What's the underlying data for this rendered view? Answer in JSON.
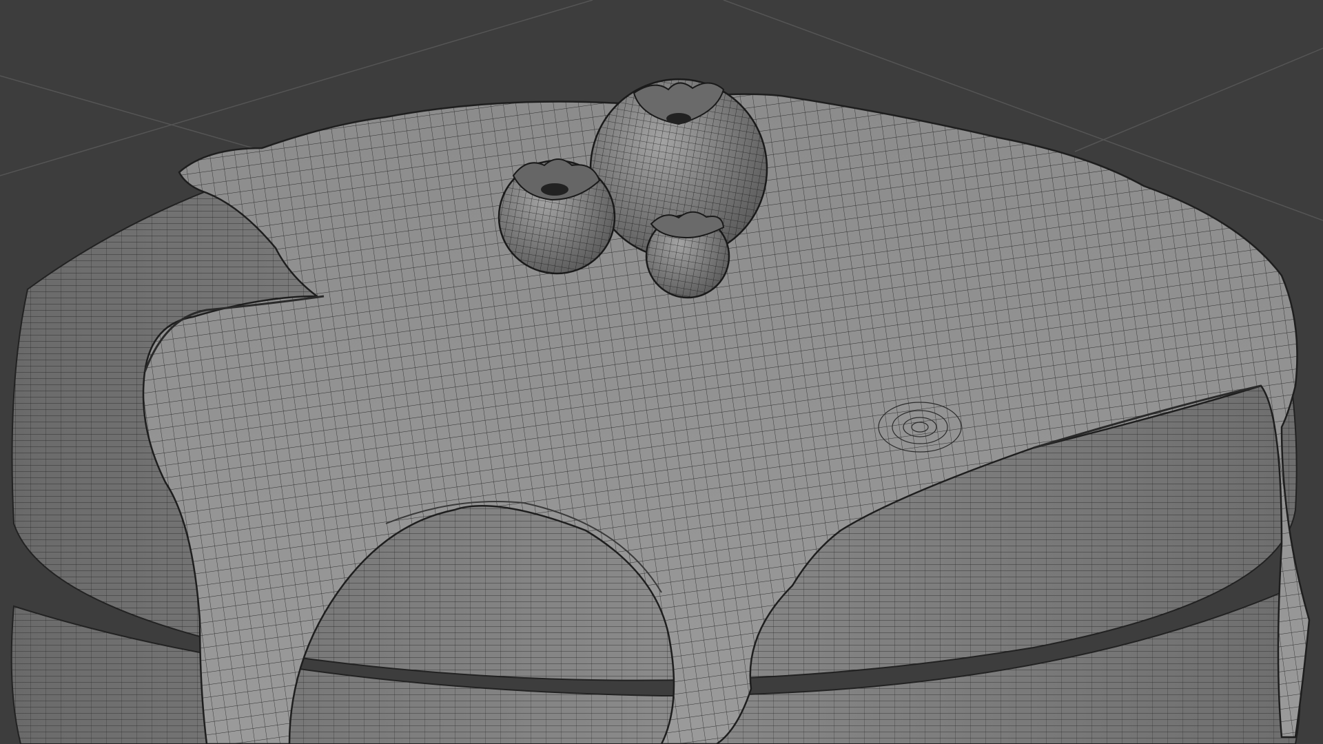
{
  "viewport": {
    "mode": "3d-viewport",
    "shading": "solid-wireframe",
    "background_color": "#3d3d3d",
    "grid_color": "#545454",
    "mesh_fill_color": "#7e7e7e",
    "mesh_wire_color": "#1a1a1a",
    "objects": [
      {
        "name": "cake-base-tier",
        "kind": "cylinder-mesh"
      },
      {
        "name": "cake-top-tier",
        "kind": "cylinder-mesh"
      },
      {
        "name": "frosting-drip-layer",
        "kind": "sculpted-mesh"
      },
      {
        "name": "berry",
        "kind": "sphere-mesh"
      },
      {
        "name": "berry",
        "kind": "sphere-mesh"
      },
      {
        "name": "berry",
        "kind": "sphere-mesh"
      }
    ]
  }
}
